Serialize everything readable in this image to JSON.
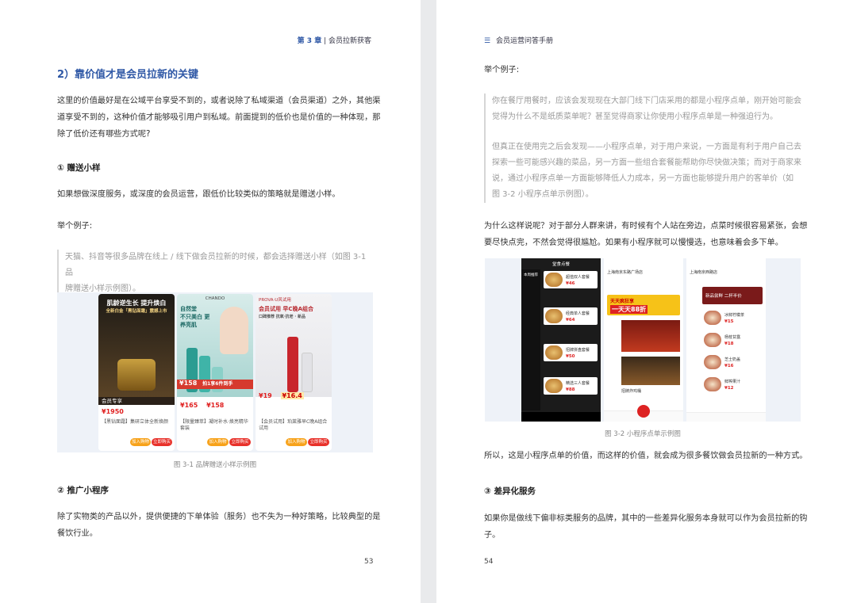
{
  "left_page": {
    "header": {
      "chapter": "第 3 章",
      "title": "会员拉新获客"
    },
    "heading": "2）靠价值才是会员拉新的关键",
    "intro_lines": [
      "这里的价值最好是在公域平台享受不到的，或者说除了私域渠道（会员渠道）之外，其他渠",
      "道享受不到的，这种价值才能够吸引用户到私域。前面提到的低价也是价值的一种体现，那",
      "除了低价还有哪些方式呢?"
    ],
    "sub1": "① 赠送小样",
    "sub1_text": "如果想做深度服务，或深度的会员运营，跟低价比较类似的策略就是赠送小样。",
    "example_label": "举个例子:",
    "quote_lines": [
      "天猫、抖音等很多品牌在线上 / 线下做会员拉新的时候，都会选择赠送小样（如图 3-1 品",
      "牌赠送小样示例图）。"
    ],
    "figure": {
      "caption": "图 3-1 品牌赠送小样示例图",
      "phones": [
        {
          "headline_1": "肌龄逆生长 提升焕白",
          "headline_2": "全新白金「黑钻面霜」震撼上市",
          "price": "¥1950",
          "member_label": "会员专享",
          "desc": "【黑钻面霜】集研立体全新焕颜",
          "buy": "加入购物车",
          "buy2": "立即购买"
        },
        {
          "brand": "CHANDO",
          "headline_1": "自然堂",
          "headline_2": "不只美白 更养亮肌",
          "price1": "¥158",
          "price_tag": "拍1享6件到手",
          "price2": "¥165",
          "price3": "¥158",
          "desc": "【限量臻萃】凝时补水·焕亮精华套装",
          "buy": "加入购物车",
          "buy2": "立即购买"
        },
        {
          "brand": "PROVA·U风试用",
          "headline_1": "会员试用 早C晚A组合",
          "headline_2": "口碑推荐 抗氧·抗老 · 新品",
          "price": "¥19",
          "price2": "¥16.4",
          "desc": "【会员试用】珀莱雅早C晚A组合试用",
          "buy": "加入购物车",
          "buy2": "立即购买"
        }
      ]
    },
    "sub2": "② 推广小程序",
    "sub2_lines": [
      "除了实物类的产品以外，提供便捷的下单体验（服务）也不失为一种好策略，比较典型的是",
      "餐饮行业。"
    ],
    "page_number": "53"
  },
  "right_page": {
    "header": {
      "icon": "menu-icon",
      "title": "会员运营问答手册"
    },
    "example_label": "举个例子:",
    "quote1_lines": [
      "你在餐厅用餐时，应该会发现现在大部门线下门店采用的都是小程序点单，刚开始可能会",
      "觉得为什么不是纸质菜单呢？甚至觉得商家让你使用小程序点单是一种强迫行为。"
    ],
    "quote2_lines": [
      "但真正在使用完之后会发现——小程序点单，对于用户来说，一方面是有利于用户自己去",
      "探索一些可能感兴趣的菜品，另一方面一些组合套餐能帮助你尽快做决策；而对于商家来",
      "说，通过小程序点单一方面能够降低人力成本，另一方面也能够提升用户的客单价（如",
      "图 3-2 小程序点单示例图）。"
    ],
    "para1_lines": [
      "为什么这样说呢？对于部分人群来讲，有时候有个人站在旁边，点菜时候很容易紧张，会想",
      "要尽快点完，不然会觉得很尴尬。如果有小程序就可以慢慢选，也意味着会多下单。"
    ],
    "figure": {
      "caption": "图 3-2 小程序点单示例图",
      "phones": [
        {
          "title": "堂食点餐",
          "category": "本周推荐",
          "items": [
            "超值双人套餐",
            "经典单人套餐",
            "招牌拼盘套餐",
            "精选三人套餐"
          ],
          "prices": [
            "¥46",
            "¥64",
            "¥50",
            "¥88"
          ]
        },
        {
          "title": "上海南京东路广场店",
          "banner_1": "天天疯狂享",
          "banner_2": "一天天88折",
          "items": [
            "招牌炸鸡桶",
            "热辣烤翅",
            "汉堡套餐"
          ]
        },
        {
          "title": "上海南京西路店",
          "banner": "新品尝鲜 二杯半价",
          "items": [
            "冰鲜柠檬茶",
            "杨枝甘露",
            "芝士奶盖",
            "鲜榨果汁"
          ],
          "prices": [
            "¥15",
            "¥18",
            "¥16",
            "¥12"
          ]
        }
      ]
    },
    "para2": "所以，这是小程序点单的价值，而这样的价值，就会成为很多餐饮做会员拉新的一种方式。",
    "sub3": "③ 差异化服务",
    "sub3_lines": [
      "如果你是做线下偏非标类服务的品牌，其中的一些差异化服务本身就可以作为会员拉新的钩",
      "子。"
    ],
    "page_number": "54"
  }
}
